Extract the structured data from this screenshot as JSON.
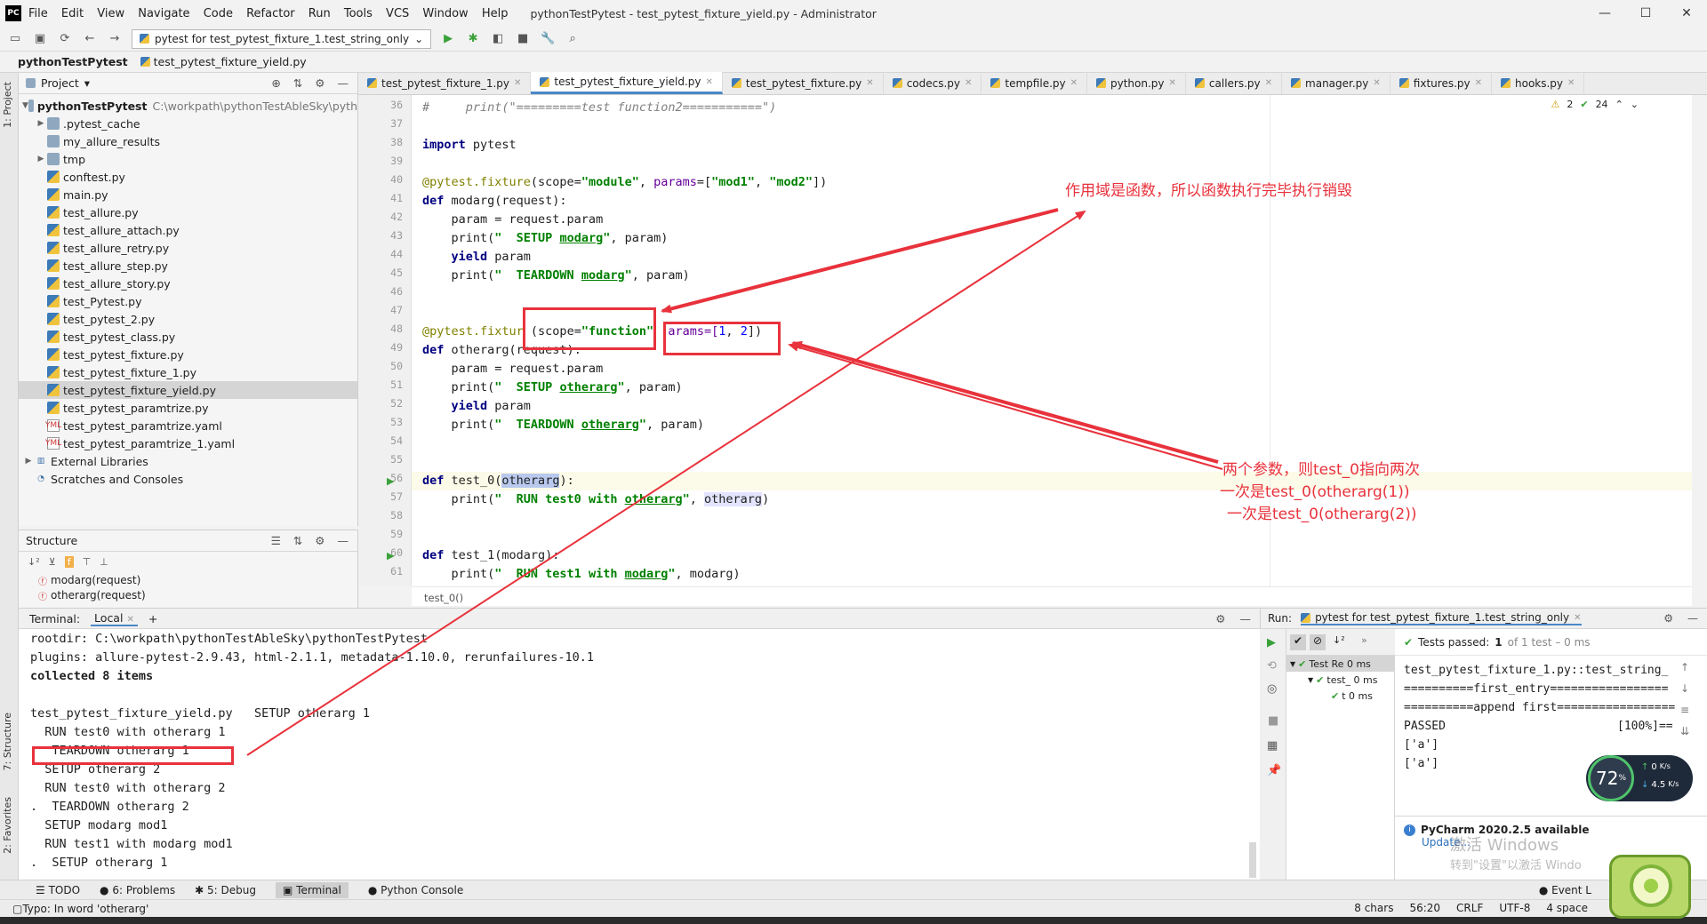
{
  "menu": [
    "File",
    "Edit",
    "View",
    "Navigate",
    "Code",
    "Refactor",
    "Run",
    "Tools",
    "VCS",
    "Window",
    "Help"
  ],
  "window_title": "pythonTestPytest - test_pytest_fixture_yield.py - Administrator",
  "run_config": "pytest for test_pytest_fixture_1.test_string_only",
  "nav": {
    "project": "pythonTestPytest",
    "file": "test_pytest_fixture_yield.py"
  },
  "project": {
    "header": "Project",
    "root": "pythonTestPytest",
    "root_path": "C:\\workpath\\pythonTestAbleSky\\pyth",
    "items": [
      ".pytest_cache",
      "my_allure_results",
      "tmp",
      "conftest.py",
      "main.py",
      "test_allure.py",
      "test_allure_attach.py",
      "test_allure_retry.py",
      "test_allure_step.py",
      "test_allure_story.py",
      "test_Pytest.py",
      "test_pytest_2.py",
      "test_pytest_class.py",
      "test_pytest_fixture.py",
      "test_pytest_fixture_1.py",
      "test_pytest_fixture_yield.py",
      "test_pytest_paramtrize.py",
      "test_pytest_paramtrize.yaml",
      "test_pytest_paramtrize_1.yaml"
    ],
    "ext": "External Libraries",
    "scratch": "Scratches and Consoles"
  },
  "structure": {
    "header": "Structure",
    "items": [
      "modarg(request)",
      "otherarg(request)"
    ]
  },
  "tabs": [
    "test_pytest_fixture_1.py",
    "test_pytest_fixture_yield.py",
    "test_pytest_fixture.py",
    "codecs.py",
    "tempfile.py",
    "python.py",
    "callers.py",
    "manager.py",
    "fixtures.py",
    "hooks.py"
  ],
  "inspections": {
    "warn": "2",
    "ok": "24"
  },
  "code": {
    "l36": "#     print(\"=========test function2===========\")",
    "l38a": "import",
    "l38b": " pytest",
    "l40a": "@pytest.fixture",
    "l40b": "(scope=",
    "l40c": "\"module\"",
    "l40d": ", ",
    "l40e": "params",
    "l40f": "=[",
    "l40g": "\"mod1\"",
    "l40h": ", ",
    "l40i": "\"mod2\"",
    "l40j": "])",
    "l41a": "def",
    "l41b": " modarg(request):",
    "l42": "    param = request.param",
    "l43a": "    print(",
    "l43b": "\"  SETUP ",
    "l43c": "modarg",
    "l43d": "\"",
    ", param)": "",
    "l43e": ", param)",
    "l44a": "    ",
    "l44b": "yield",
    "l44c": " param",
    "l45a": "    print(",
    "l45b": "\"  TEARDOWN ",
    "l45c": "modarg",
    "l45d": "\"",
    "l45e": ", param)",
    "l48a": "@pytest.fixtur",
    "l48b": " (scope=",
    "l48c": "\"function\"",
    "l48d": "  ",
    "l48e": "arams=[",
    "l48f": "1",
    ", ": "",
    "l48g": ", ",
    "l48h": "2",
    "l48i": "])",
    "l49a": "def",
    "l49b": " otherarg(request):",
    "l50": "    param = request.param",
    "l51a": "    print(",
    "l51b": "\"  SETUP ",
    "l51c": "otherarg",
    "l51d": "\"",
    "l51e": ", param)",
    "l52a": "    ",
    "l52b": "yield",
    "l52c": " param",
    "l53a": "    print(",
    "l53b": "\"  TEARDOWN ",
    "l53c": "otherarg",
    "l53d": "\"",
    "l53e": ", param)",
    "l56a": "def",
    "l56b": " test_0(",
    "l56c": "otherarg",
    "l56d": "):",
    "l57a": "    print(",
    "l57b": "\"  RUN test0 with ",
    "l57c": "otherarg",
    "l57d": "\"",
    "l57e": ", ",
    "l57f": "otherarg",
    "l57g": ")",
    "l60a": "def",
    "l60b": " test_1(modarg):",
    "l61a": "    print(",
    "l61b": "\"  RUN test1 with ",
    "l61c": "modarg",
    "l61d": "\"",
    "l61e": ", modarg)"
  },
  "line_numbers": [
    "36",
    "37",
    "38",
    "39",
    "40",
    "41",
    "42",
    "43",
    "44",
    "45",
    "46",
    "47",
    "48",
    "49",
    "50",
    "51",
    "52",
    "53",
    "54",
    "55",
    "56",
    "57",
    "58",
    "59",
    "60",
    "61"
  ],
  "editor_breadcrumb": "test_0()",
  "terminal": {
    "label": "Terminal:",
    "tab": "Local",
    "lines": [
      "rootdir: C:\\workpath\\pythonTestAbleSky\\pythonTestPytest",
      "plugins: allure-pytest-2.9.43, html-2.1.1, metadata-1.10.0, rerunfailures-10.1",
      "collected 8 items",
      "",
      "test_pytest_fixture_yield.py   SETUP otherarg 1",
      "  RUN test0 with otherarg 1",
      "   TEARDOWN otherarg 1",
      "  SETUP otherarg 2",
      "  RUN test0 with otherarg 2",
      ".  TEARDOWN otherarg 2",
      "  SETUP modarg mod1",
      "  RUN test1 with modarg mod1",
      ".  SETUP otherarg 1"
    ]
  },
  "run": {
    "label": "Run:",
    "config": "pytest for test_pytest_fixture_1.test_string_only",
    "passed": "Tests passed:",
    "passed_count": "1",
    "passed_of": "of 1 test – 0 ms",
    "tree": [
      "Test Re 0 ms",
      "test_ 0 ms",
      "t 0 ms"
    ],
    "out": [
      "test_pytest_fixture_1.py::test_string_",
      "==========first_entry=================",
      "==========append first=================",
      "PASSED",
      "['a']",
      "['a']"
    ],
    "pct": "[100%]=="
  },
  "notification": {
    "title": "PyCharm 2020.2.5 available",
    "link": "Update...",
    "wm1": "激活 Windows",
    "wm2": "转到\"设置\"以激活 Windo"
  },
  "speed": {
    "pct": "72",
    "pct_unit": "%",
    "up": "0",
    "down": "4.5",
    "unit": "K/s"
  },
  "bottom_tabs": [
    "TODO",
    "6: Problems",
    "5: Debug",
    "Terminal",
    "Python Console"
  ],
  "status": {
    "left": "Typo: In word 'otherarg'",
    "chars": "8 chars",
    "pos": "56:20",
    "crlf": "CRLF",
    "enc": "UTF-8",
    "indent": "4 space",
    "event": "Event L"
  },
  "annotations": {
    "note1": "作用域是函数，所以函数执行完毕执行销毁",
    "note2a": "两个参数，则test_0指向两次",
    "note2b": "一次是test_0(otherarg(1))",
    "note2c": "一次是test_0(otherarg(2))"
  },
  "colors": {
    "annotation": "#e8323c",
    "keyword": "#000080",
    "string": "#008000"
  }
}
